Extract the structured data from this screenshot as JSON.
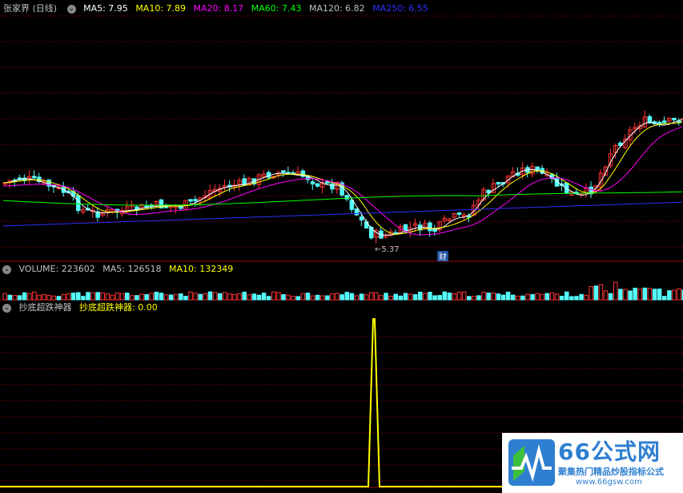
{
  "main_panel": {
    "title": "张家界 (日线)",
    "ma": [
      {
        "label": "MA5: 7.95",
        "color": "#ffffff"
      },
      {
        "label": "MA10: 7.89",
        "color": "#ffff00"
      },
      {
        "label": "MA20: 8.17",
        "color": "#ff00ff"
      },
      {
        "label": "MA60: 7.43",
        "color": "#00ff00"
      },
      {
        "label": "MA120: 6.82",
        "color": "#c0c0c0"
      },
      {
        "label": "MA250: 6.55",
        "color": "#3030ff"
      }
    ],
    "low_marker": "5.37",
    "event_marker": "财"
  },
  "volume_panel": {
    "title": "VOLUME: 223602",
    "ma5": "MA5: 126518",
    "ma10": "MA10: 132349"
  },
  "indicator_panel": {
    "title": "抄底超跌神器",
    "value": "抄底超跌神器: 0.00"
  },
  "watermark": {
    "title": "66公式网",
    "subtitle": "聚集热门精品炒股指标公式",
    "url": "www.66gsw.com"
  },
  "colors": {
    "up": "#ff3232",
    "down": "#54fcfc",
    "grid": "#8b0000",
    "ma5": "#ffffff",
    "ma10": "#ffff00",
    "ma20": "#ff00ff",
    "ma60": "#00ff00",
    "ma250": "#3030ff",
    "indicator": "#ffff00"
  }
}
